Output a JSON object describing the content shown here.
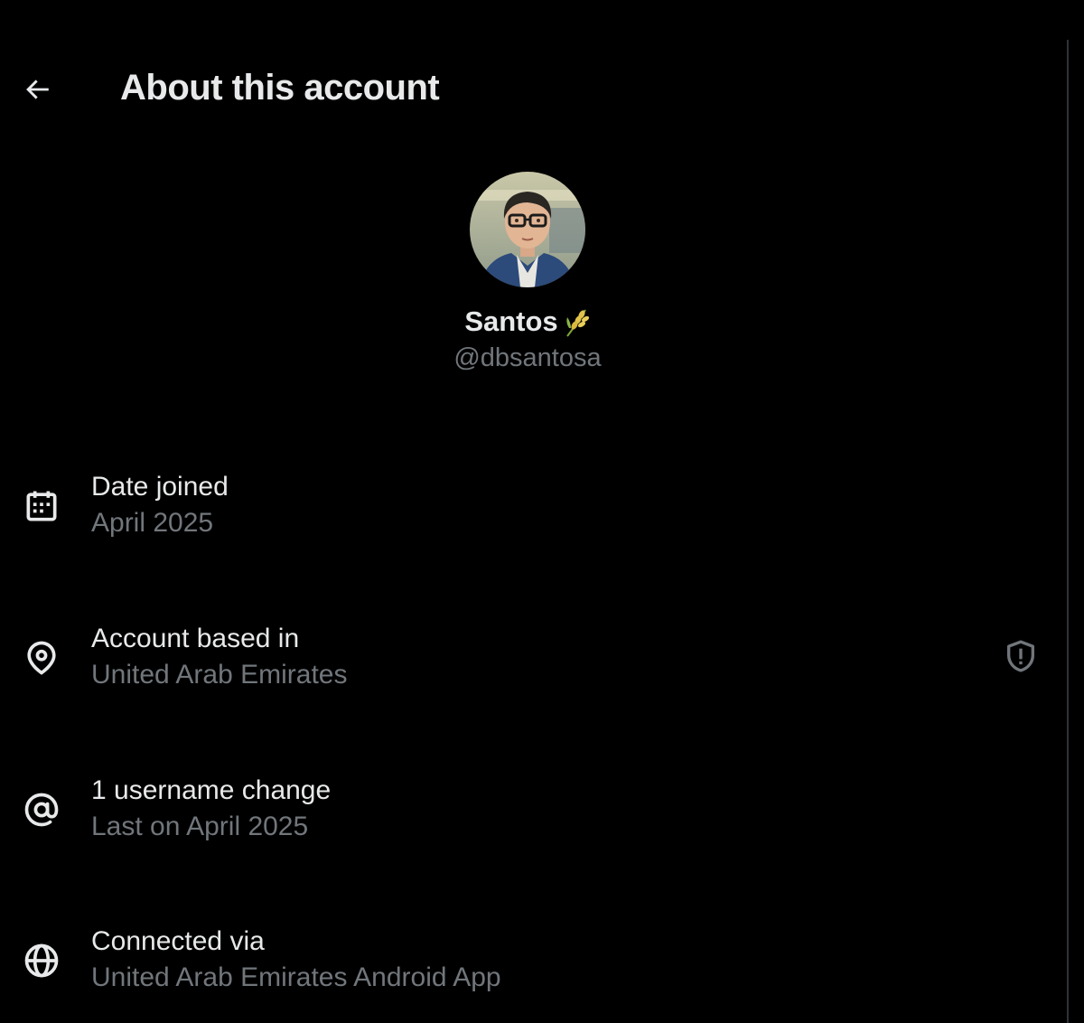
{
  "header": {
    "title": "About this account",
    "back_icon": "arrow-left-icon"
  },
  "profile": {
    "display_name": "Santos",
    "name_badge_icon": "wheat-emoji-icon",
    "handle": "@dbsantosa"
  },
  "details": [
    {
      "icon": "calendar-icon",
      "label": "Date joined",
      "value": "April 2025"
    },
    {
      "icon": "location-pin-icon",
      "label": "Account based in",
      "value": "United Arab Emirates",
      "trailing_icon": "shield-alert-icon"
    },
    {
      "icon": "at-sign-icon",
      "label": "1 username change",
      "value": "Last on April 2025"
    },
    {
      "icon": "globe-icon",
      "label": "Connected via",
      "value": "United Arab Emirates Android App"
    }
  ],
  "colors": {
    "background": "#000000",
    "primary_text": "#e7e9ea",
    "secondary_text": "#71767b",
    "divider": "#2f3336"
  }
}
